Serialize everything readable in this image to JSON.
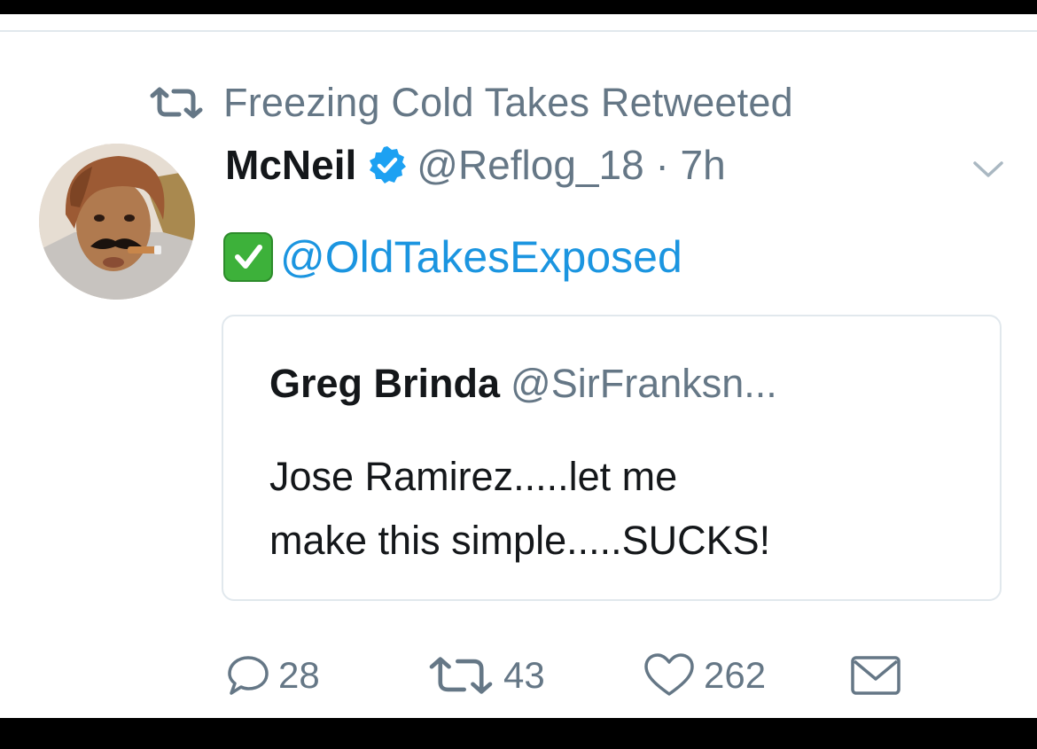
{
  "social_context": {
    "text": "Freezing Cold Takes Retweeted",
    "icon": "retweet-icon"
  },
  "tweet": {
    "display_name": "McNeil",
    "verified": true,
    "handle_time": "@Reflog_18 · 7h",
    "body_emoji": "white-check-mark-emoji",
    "body_mention": "@OldTakesExposed"
  },
  "quoted_tweet": {
    "display_name": "Greg Brinda",
    "handle": "@SirFranksn...",
    "text_lines": [
      "Jose Ramirez.....let me",
      "make this simple.....SUCKS!"
    ]
  },
  "actions": {
    "reply_count": "28",
    "retweet_count": "43",
    "like_count": "262"
  },
  "colors": {
    "link_blue": "#1b95e0",
    "gray_text": "#657786",
    "dark_text": "#14171a",
    "border": "#e1e8ed",
    "emoji_green": "#3db13a"
  }
}
